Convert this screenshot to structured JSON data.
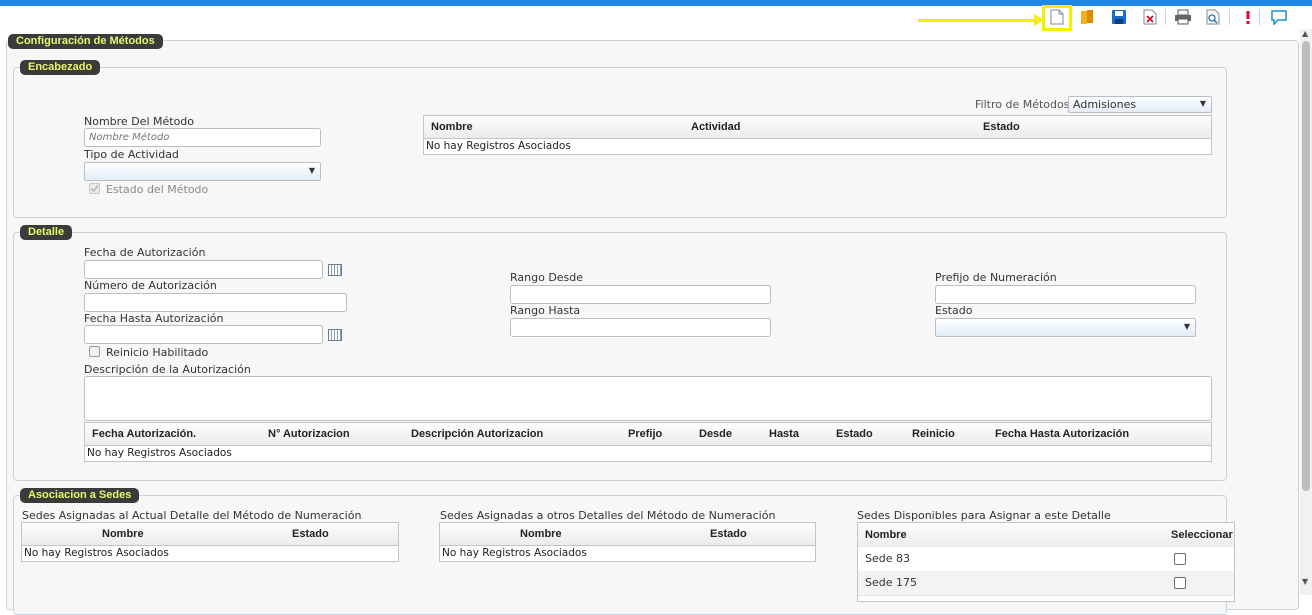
{
  "toolbar": {
    "icons": [
      "new-icon",
      "open-icon",
      "save-icon",
      "delete-icon",
      "print-icon",
      "preview-icon",
      "alert-icon",
      "comment-icon"
    ]
  },
  "sections": {
    "main": "Configuración de Métodos",
    "encabezado": "Encabezado",
    "detalle": "Detalle",
    "sedes": "Asociacion a Sedes"
  },
  "encabezado": {
    "nombre_label": "Nombre Del Método",
    "nombre_placeholder": "Nombre Método",
    "tipo_label": "Tipo de Actividad",
    "tipo_value": "",
    "estado_label": "Estado del Método",
    "filtro_label": "Filtro de Métodos",
    "filtro_value": "Admisiones",
    "table": {
      "columns": [
        "Nombre",
        "Actividad",
        "Estado"
      ],
      "empty": "No hay Registros Asociados"
    }
  },
  "detalle": {
    "fecha_aut_label": "Fecha de Autorización",
    "numero_aut_label": "Número de Autorización",
    "fecha_hasta_label": "Fecha Hasta Autorización",
    "reinicio_label": "Reinicio Habilitado",
    "rango_desde_label": "Rango Desde",
    "rango_hasta_label": "Rango Hasta",
    "prefijo_label": "Prefijo de Numeración",
    "estado_label": "Estado",
    "estado_value": "",
    "descripcion_label": "Descripción de la Autorización",
    "table": {
      "columns": [
        "Fecha Autorización.",
        "N° Autorizacion",
        "Descripción Autorizacion",
        "Prefijo",
        "Desde",
        "Hasta",
        "Estado",
        "Reinicio",
        "Fecha Hasta Autorización"
      ],
      "empty": "No hay Registros Asociados"
    }
  },
  "sedes": {
    "actual_title": "Sedes Asignadas al Actual Detalle del Método de Numeración",
    "actual_columns": [
      "Nombre",
      "Estado"
    ],
    "actual_empty": "No hay Registros Asociados",
    "otros_title": "Sedes Asignadas a otros Detalles del Método de Numeración",
    "otros_columns": [
      "Nombre",
      "Estado"
    ],
    "otros_empty": "No hay Registros Asociados",
    "disponibles_title": "Sedes Disponibles para Asignar a este Detalle",
    "disponibles_columns": [
      "Nombre",
      "Seleccionar"
    ],
    "disponibles_rows": [
      {
        "nombre": "Sede 83",
        "selected": false
      },
      {
        "nombre": "Sede 175",
        "selected": false
      }
    ]
  },
  "colors": {
    "legend_bg": "#3b3b3b",
    "legend_text": "#e9f76a",
    "highlight": "#f4f000",
    "topbar": "#1e88e5"
  }
}
